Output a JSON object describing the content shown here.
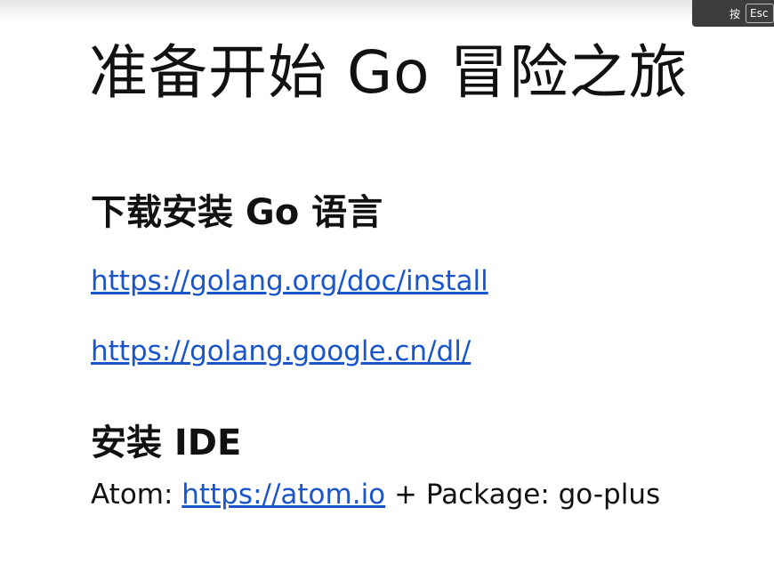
{
  "overlay": {
    "hint_text": "按",
    "esc_label": "Esc"
  },
  "slide": {
    "title": "准备开始 Go 冒险之旅",
    "section_install_go": "下载安装 Go 语言",
    "links": [
      "https://golang.org/doc/install",
      "https://golang.google.cn/dl/"
    ],
    "section_install_ide": "安装 IDE",
    "atom_prefix": "Atom: ",
    "atom_link": "https://atom.io",
    "atom_suffix": " + Package: go-plus"
  },
  "colors": {
    "link": "#1a55c9",
    "text": "#111111",
    "background": "#ffffff"
  }
}
